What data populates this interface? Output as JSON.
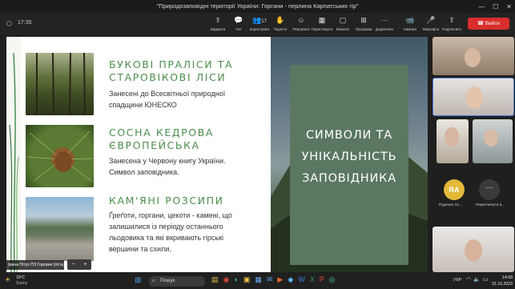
{
  "window": {
    "title": "\"Природозаповідні території України: Горгани - перлина Карпатських гір\""
  },
  "toolbar": {
    "time": "17:35",
    "items": [
      {
        "icon": "share-screen-icon",
        "label": "Відкрити"
      },
      {
        "icon": "chat-icon",
        "label": "Чат"
      },
      {
        "icon": "people-icon",
        "label": "Користувачі",
        "count": "17"
      },
      {
        "icon": "hand-icon",
        "label": "Підняти"
      },
      {
        "icon": "reaction-icon",
        "label": "Реагувати"
      },
      {
        "icon": "view-icon",
        "label": "Переглянути"
      },
      {
        "icon": "rooms-icon",
        "label": "Кімнати"
      },
      {
        "icon": "apps-icon",
        "label": "Програми"
      },
      {
        "icon": "more-icon",
        "label": "Додатково"
      }
    ],
    "camera_label": "Камера",
    "mic_label": "Мікрофон",
    "share_label": "Поділитися",
    "leave_label": "Вийти"
  },
  "slide": {
    "item1_title": "БУКОВІ ПРАЛІСИ ТА СТАРОВІКОВІ ЛІСИ",
    "item1_desc": "Занесені до Всесвітньої природної спадщини ЮНЕСКО",
    "item2_title": "СОСНА КЕДРОВА ЄВРОПЕЙСЬКА",
    "item2_desc": "Занесена у Червону книгу України. Символ заповідника.",
    "item3_title": "КАМ'ЯНІ РОЗСИПИ",
    "item3_desc": "Ґреґоти, горгани, цекоти - камені, що залишилися із періоду останнього льодовика та які вкривають гірські вершини та схили.",
    "symbol_title": "СИМВОЛИ ТА УНІКАЛЬНІСТЬ ЗАПОВІДНИКА"
  },
  "presenter_name": "Ірина Пітух ПЗ Горгани (гість)",
  "participants": {
    "ra_initials": "RA",
    "ra_name": "Руденко Га...",
    "more_label": "Переглянути в..."
  },
  "taskbar": {
    "weather": "19°C",
    "weather_desc": "Sunny",
    "search_placeholder": "Пошук",
    "lang": "УКР",
    "clock_time": "14:08",
    "clock_date": "31.10.2023"
  }
}
